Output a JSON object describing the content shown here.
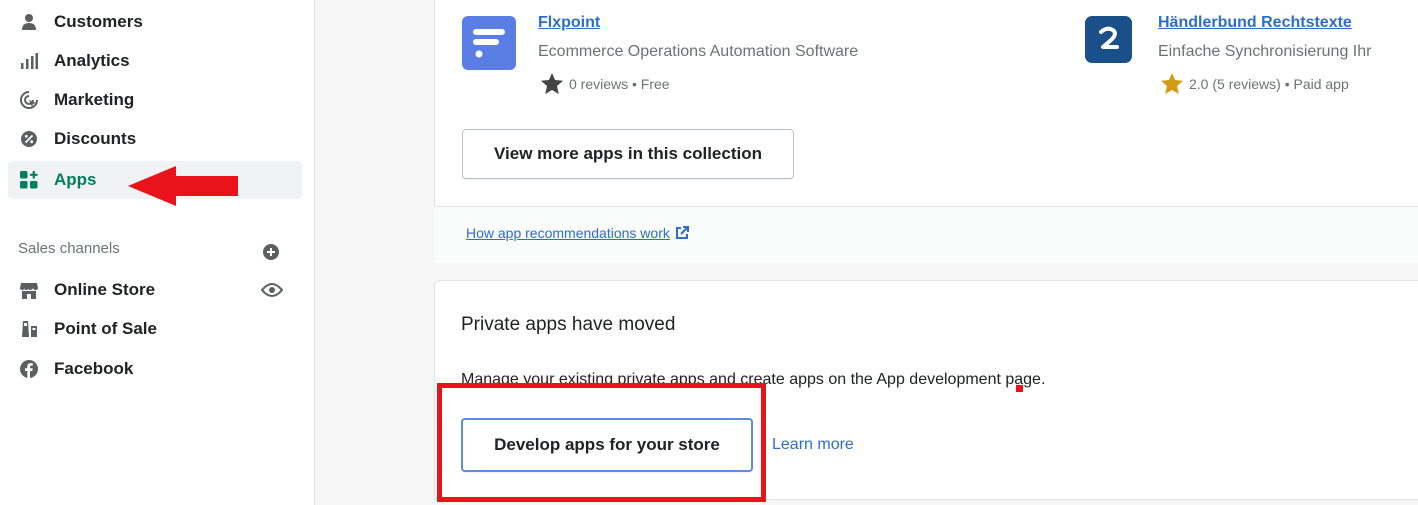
{
  "sidebar": {
    "items": [
      {
        "label": "Customers",
        "icon": "person-icon"
      },
      {
        "label": "Analytics",
        "icon": "bar-chart-icon"
      },
      {
        "label": "Marketing",
        "icon": "target-icon"
      },
      {
        "label": "Discounts",
        "icon": "discount-icon"
      },
      {
        "label": "Apps",
        "icon": "apps-icon",
        "active": true
      }
    ],
    "sales_channels_label": "Sales channels",
    "channels": [
      {
        "label": "Online Store",
        "icon": "store-icon"
      },
      {
        "label": "Point of Sale",
        "icon": "pos-icon"
      },
      {
        "label": "Facebook",
        "icon": "facebook-icon"
      }
    ]
  },
  "collection": {
    "apps": [
      {
        "name": "Flxpoint",
        "description": "Ecommerce Operations Automation Software",
        "meta": "0 reviews • Free",
        "logo_color": "#5b7ee5"
      },
      {
        "name": "Händlerbund Rechtstexte",
        "description": "Einfache Synchronisierung Ihr",
        "meta": "2.0 (5 reviews) • Paid app",
        "logo_color": "#1a4f8a"
      }
    ],
    "view_more_label": "View more apps in this collection",
    "recommendations_link": "How app recommendations work"
  },
  "private_apps": {
    "heading": "Private apps have moved",
    "body": "Manage your existing private apps and create apps on the App development page.",
    "develop_button": "Develop apps for your store",
    "learn_more": "Learn more"
  },
  "colors": {
    "accent": "#008060",
    "link": "#2c6ecb",
    "annotation": "#e8131b",
    "star_gold": "#d39a15"
  }
}
